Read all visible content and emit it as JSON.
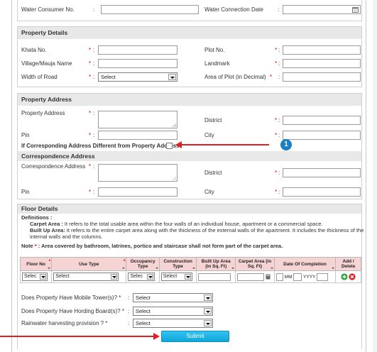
{
  "top": {
    "water_consumer_no_label": "Water Consumer No.",
    "water_connection_date_label": "Water Connection Date"
  },
  "property_details": {
    "title": "Property Details",
    "khata_label": "Khata No.",
    "plot_label": "Plot No.",
    "village_label": "Village/Mauja Name",
    "landmark_label": "Landmark",
    "road_label": "Width of Road",
    "road_value": "Select",
    "area_label": "Area of Plot (in Decimal)"
  },
  "property_address": {
    "title": "Property Address",
    "address_label": "Property Address",
    "district_label": "District",
    "pin_label": "Pin",
    "city_label": "City",
    "corr_question": "If Corresponding Address Different from Property Address",
    "badge": "1"
  },
  "correspondence": {
    "title": "Correspondence Address",
    "address_label": "Correspondence Address",
    "district_label": "District",
    "pin_label": "Pin",
    "city_label": "City"
  },
  "floor": {
    "title": "Floor Details",
    "definitions_label": "Definitions :",
    "carpet_term": "Carpet Area :",
    "carpet_text": "It refers to the total usable area within the four walls of an individual house, apartment or a commercial space.",
    "builtup_term": "Built Up Area:",
    "builtup_text": "It refers to the entire carpet area along with the thickness of the external walls of the apartment. It includes the thickness of the",
    "builtup_text2": "internal walls and the columns.",
    "note_prefix": "Note",
    "note_star": "*",
    "note_text": ": Area covered by bathroom, latrines, portico and staircase shall not form part of the carpet area.",
    "columns": [
      "Floor No",
      "Use Type",
      "Occupancy Type",
      "Construction Type",
      "Built Up Area (in Sq. Ft)",
      "Carpet Area (in Sq. Ft)",
      "Date Of Completion",
      "Add / Delete"
    ],
    "row": {
      "floor_no": "Selec",
      "use_type": "Select",
      "occupancy": "Selec",
      "construction": "Select",
      "mm": "MM",
      "yyyy": "YYYY"
    }
  },
  "questions": {
    "mobile_tower": "Does Property Have Mobile Tower(s)? *",
    "mobile_tower_value": "Select",
    "hording": "Does Property Have Hording Board(s)? *",
    "hording_value": "Select",
    "rainwater": "Rainwater harvesting provision ? *",
    "rainwater_value": "Select"
  },
  "submit_label": "Submit",
  "symbols": {
    "colon": ":",
    "star": "*"
  },
  "icons": {
    "calendar": "calendar-icon",
    "add": "plus-circle-icon",
    "delete": "close-circle-icon"
  },
  "colors": {
    "section_head": "#e8e8e8",
    "table_head": "#f7d4d4",
    "required": "#e60000",
    "submit": "#1ab0e3",
    "arrow": "#e02020",
    "badge": "#1a7fc4"
  }
}
